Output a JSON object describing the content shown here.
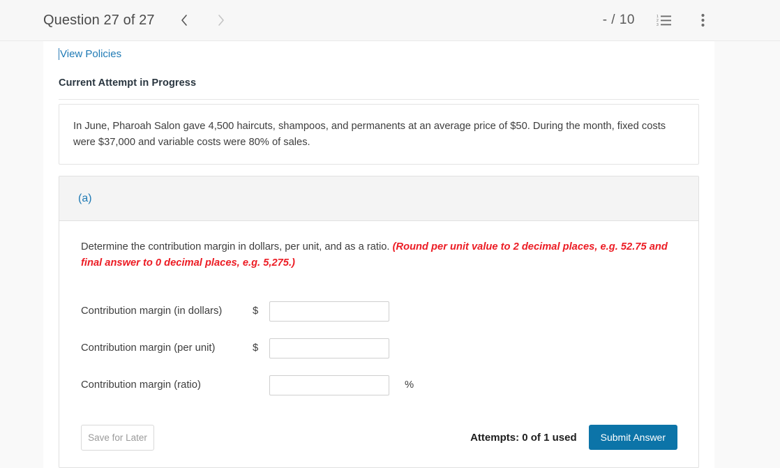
{
  "header": {
    "question_title": "Question 27 of 27",
    "prev_icon": "chevron-left-icon",
    "next_icon": "chevron-right-icon",
    "score": "- / 10",
    "list_icon": "numbered-list-icon",
    "menu_icon": "kebab-menu-icon"
  },
  "content": {
    "view_policies_label": "View Policies",
    "attempt_heading": "Current Attempt in Progress",
    "question_text": "In June, Pharoah Salon gave 4,500 haircuts, shampoos, and permanents at an average price of $50. During the month, fixed costs were $37,000 and variable costs were 80% of sales."
  },
  "part": {
    "label": "(a)",
    "instruction_main": "Determine the contribution margin in dollars, per unit, and as a ratio.",
    "instruction_hint": "(Round per unit value to 2 decimal places, e.g. 52.75 and final answer to 0 decimal places, e.g. 5,275.)",
    "fields": [
      {
        "label": "Contribution margin (in dollars)",
        "prefix": "$",
        "value": "",
        "placeholder": "",
        "suffix": ""
      },
      {
        "label": "Contribution margin (per unit)",
        "prefix": "$",
        "value": "",
        "placeholder": "",
        "suffix": ""
      },
      {
        "label": "Contribution margin (ratio)",
        "prefix": "",
        "value": "",
        "placeholder": "",
        "suffix": "%"
      }
    ]
  },
  "footer": {
    "save_label": "Save for Later",
    "attempts_text": "Attempts: 0 of 1 used",
    "submit_label": "Submit Answer"
  },
  "colors": {
    "link": "#1f7ab5",
    "hint_red": "#ec1c24",
    "submit_blue": "#0c74a8",
    "page_bg": "#f9f9f9",
    "panel_header": "#f4f4f4"
  }
}
